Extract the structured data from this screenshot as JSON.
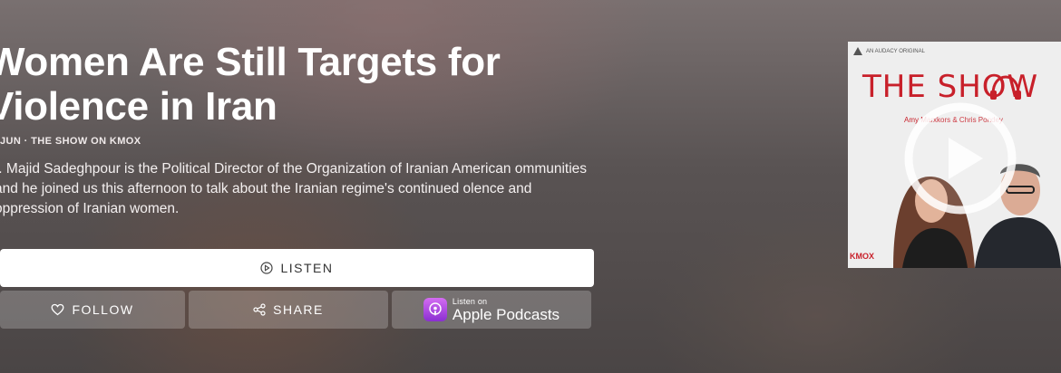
{
  "episode": {
    "title": "Women Are Still Targets for Violence in Iran",
    "meta": "JUN · THE SHOW ON KMOX",
    "description": "r. Majid Sadeghpour is the Political Director of the Organization of Iranian American ommunities and he joined us this afternoon to talk about the Iranian regime's continued olence and oppression of Iranian women."
  },
  "actions": {
    "listen_label": "LISTEN",
    "follow_label": "FOLLOW",
    "share_label": "SHARE",
    "apple_small": "Listen on",
    "apple_big": "Apple Podcasts"
  },
  "artwork": {
    "badge": "AN AUDACY ORIGINAL",
    "show_title": "THE SHOW",
    "hosts": "Amy Marxkors & Chris Pondey",
    "station": "KMOX"
  },
  "colors": {
    "brand_red": "#c8202a",
    "apple_purple": "#a542e0"
  }
}
